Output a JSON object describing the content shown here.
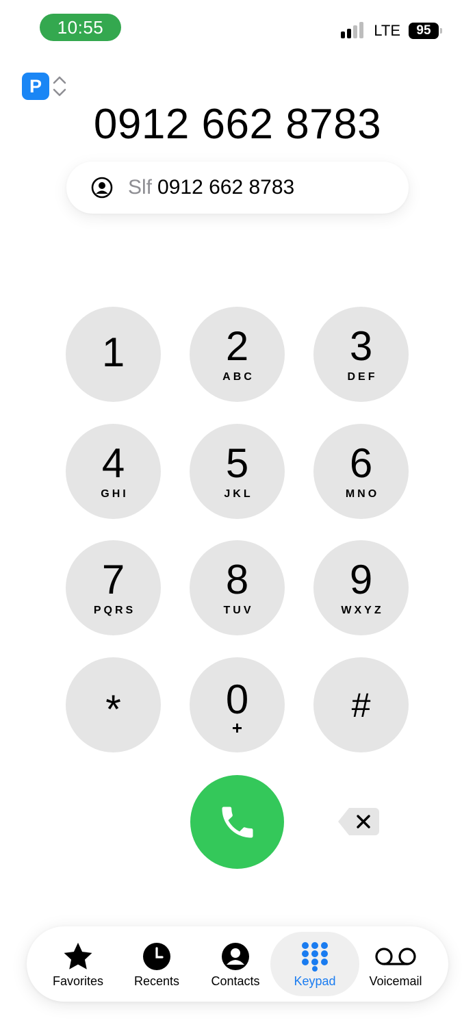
{
  "status_bar": {
    "time": "10:55",
    "network": "LTE",
    "battery": "95",
    "time_pill_color": "#34a84f"
  },
  "line_selector": {
    "badge": "P",
    "badge_color": "#1a86f5"
  },
  "dialed_number": "0912 662 8783",
  "suggestion": {
    "label": "Slf",
    "number": "0912 662 8783"
  },
  "keypad": {
    "keys": [
      {
        "digit": "1",
        "letters": ""
      },
      {
        "digit": "2",
        "letters": "ABC"
      },
      {
        "digit": "3",
        "letters": "DEF"
      },
      {
        "digit": "4",
        "letters": "GHI"
      },
      {
        "digit": "5",
        "letters": "JKL"
      },
      {
        "digit": "6",
        "letters": "MNO"
      },
      {
        "digit": "7",
        "letters": "PQRS"
      },
      {
        "digit": "8",
        "letters": "TUV"
      },
      {
        "digit": "9",
        "letters": "WXYZ"
      },
      {
        "digit": "*",
        "letters": ""
      },
      {
        "digit": "0",
        "letters": "+"
      },
      {
        "digit": "#",
        "letters": ""
      }
    ],
    "call_color": "#34c85a"
  },
  "tabs": [
    {
      "label": "Favorites",
      "icon": "star-icon",
      "active": false
    },
    {
      "label": "Recents",
      "icon": "clock-icon",
      "active": false
    },
    {
      "label": "Contacts",
      "icon": "contact-icon",
      "active": false
    },
    {
      "label": "Keypad",
      "icon": "keypad-icon",
      "active": true
    },
    {
      "label": "Voicemail",
      "icon": "voicemail-icon",
      "active": false
    }
  ],
  "accent_color": "#1a7cf0"
}
